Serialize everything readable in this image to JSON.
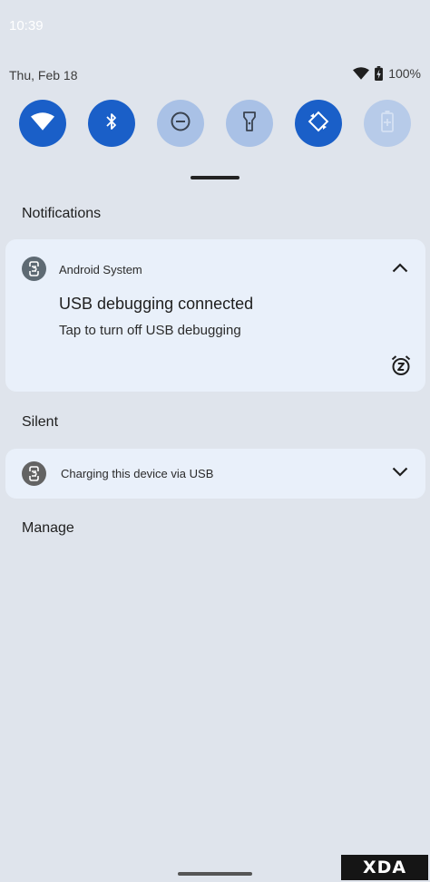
{
  "status_bar": {
    "time": "10:39"
  },
  "header": {
    "date": "Thu, Feb 18",
    "wifi_icon": "wifi-icon",
    "battery_icon": "battery-icon",
    "battery_percent": "100%"
  },
  "quick_settings": {
    "tiles": [
      {
        "name": "wifi",
        "icon": "wifi-icon",
        "state": "on"
      },
      {
        "name": "bluetooth",
        "icon": "bluetooth-icon",
        "state": "on"
      },
      {
        "name": "do-not-disturb",
        "icon": "do-not-disturb-icon",
        "state": "off"
      },
      {
        "name": "flashlight",
        "icon": "flashlight-icon",
        "state": "off"
      },
      {
        "name": "auto-rotate",
        "icon": "auto-rotate-icon",
        "state": "on"
      },
      {
        "name": "battery-saver",
        "icon": "battery-saver-icon",
        "state": "unavailable"
      }
    ],
    "colors": {
      "on": "#1a5fc8",
      "off": "#a9c1e6"
    }
  },
  "sections": {
    "notifications": "Notifications",
    "silent": "Silent",
    "manage": "Manage"
  },
  "notifications": [
    {
      "app_name": "Android System",
      "title": "USB debugging connected",
      "text": "Tap to turn off USB debugging",
      "expanded": true
    }
  ],
  "silent_notifications": [
    {
      "title": "Charging this device via USB",
      "expanded": false
    }
  ],
  "watermark": "XDA"
}
